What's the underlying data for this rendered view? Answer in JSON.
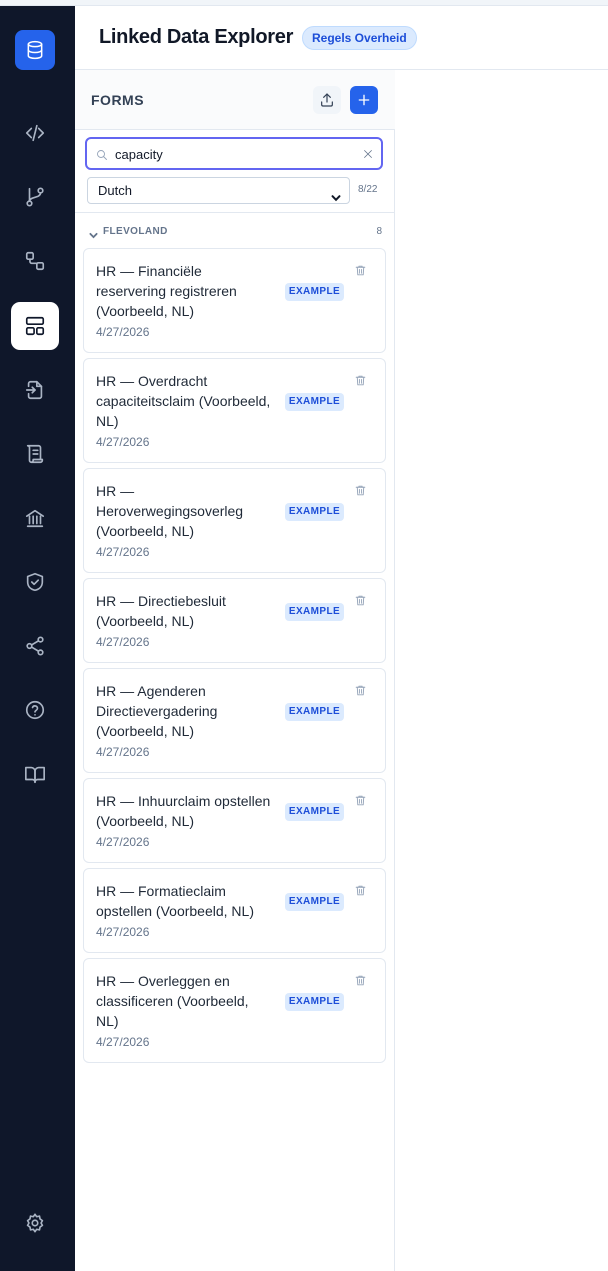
{
  "header": {
    "title": "Linked Data Explorer",
    "badge": "Regels Overheid"
  },
  "rail": {
    "items": [
      {
        "icon": "database-icon",
        "active": false,
        "logo": true
      },
      {
        "icon": "code-icon",
        "active": false
      },
      {
        "icon": "git-branch-icon",
        "active": false
      },
      {
        "icon": "workflow-icon",
        "active": false
      },
      {
        "icon": "forms-layout-icon",
        "active": true
      },
      {
        "icon": "file-import-icon",
        "active": false
      },
      {
        "icon": "scroll-icon",
        "active": false
      },
      {
        "icon": "landmark-icon",
        "active": false
      },
      {
        "icon": "shield-check-icon",
        "active": false
      },
      {
        "icon": "share-icon",
        "active": false
      },
      {
        "icon": "help-circle-icon",
        "active": false
      },
      {
        "icon": "book-open-icon",
        "active": false
      },
      {
        "icon": "settings-icon",
        "active": false
      }
    ]
  },
  "forms": {
    "title": "FORMS",
    "search": {
      "value": "capacity"
    },
    "language": "Dutch",
    "count": "8/22",
    "group": {
      "name": "FLEVOLAND",
      "count": "8"
    },
    "items": [
      {
        "title": "HR — Financiële reservering registreren (Voorbeeld, NL)",
        "date": "4/27/2026",
        "badge": "EXAMPLE"
      },
      {
        "title": "HR — Overdracht capaciteitsclaim (Voorbeeld, NL)",
        "date": "4/27/2026",
        "badge": "EXAMPLE"
      },
      {
        "title": "HR — Heroverwegingsoverleg (Voorbeeld, NL)",
        "date": "4/27/2026",
        "badge": "EXAMPLE"
      },
      {
        "title": "HR — Directiebesluit (Voorbeeld, NL)",
        "date": "4/27/2026",
        "badge": "EXAMPLE"
      },
      {
        "title": "HR — Agenderen Directievergadering (Voorbeeld, NL)",
        "date": "4/27/2026",
        "badge": "EXAMPLE"
      },
      {
        "title": "HR — Inhuurclaim opstellen (Voorbeeld, NL)",
        "date": "4/27/2026",
        "badge": "EXAMPLE"
      },
      {
        "title": "HR — Formatieclaim opstellen (Voorbeeld, NL)",
        "date": "4/27/2026",
        "badge": "EXAMPLE"
      },
      {
        "title": "HR — Overleggen en classificeren (Voorbeeld, NL)",
        "date": "4/27/2026",
        "badge": "EXAMPLE"
      }
    ]
  }
}
